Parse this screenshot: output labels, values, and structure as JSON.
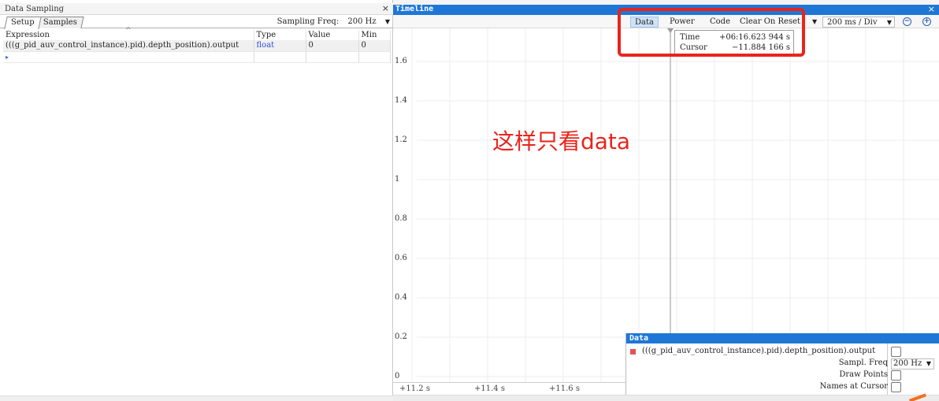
{
  "data_sampling": {
    "title": "Data Sampling",
    "close": "×",
    "tabs": [
      "Setup",
      "Samples"
    ],
    "sampling_freq_label": "Sampling Freq:",
    "sampling_freq_value": "200 Hz",
    "dropdown_arrow": "▼",
    "columns": [
      "Expression",
      "Type",
      "Value",
      "Min"
    ],
    "rows": [
      {
        "expression": "(((g_pid_auv_control_instance).pid).depth_position).output",
        "type": "float",
        "value": "0",
        "min": "0"
      }
    ],
    "new_row_marker": "▸"
  },
  "timeline": {
    "title": "Timeline",
    "close": "×",
    "toolbar": {
      "data": "Data",
      "power": "Power",
      "code": "Code",
      "clear_on_reset": "Clear On Reset",
      "time_per_div": "200 ms / Div",
      "zoom_out": "−",
      "zoom_in": "+"
    },
    "cursor_readout": {
      "time_label": "Time",
      "time_value": "+06:16.623 944 s",
      "cursor_label": "Cursor",
      "cursor_value": "−11.884 166 s"
    },
    "annotation": "这样只看data"
  },
  "chart_data": {
    "type": "line",
    "y_ticks": [
      "1.6",
      "1.4",
      "1.2",
      "1",
      "0.8",
      "0.6",
      "0.4",
      "0.2",
      "0"
    ],
    "x_ticks": [
      "+11.2 s",
      "+11.4 s",
      "+11.6 s"
    ],
    "ylim": [
      0,
      1.8
    ],
    "grid": true,
    "series": []
  },
  "data_popup": {
    "title": "Data",
    "series_name": "(((g_pid_auv_control_instance).pid).depth_position).output",
    "series_color": "#e05555",
    "sampl_freq_label": "Sampl. Freq",
    "sampl_freq_value": "200 Hz",
    "draw_points_label": "Draw Points",
    "names_at_cursor_label": "Names at Cursor"
  }
}
